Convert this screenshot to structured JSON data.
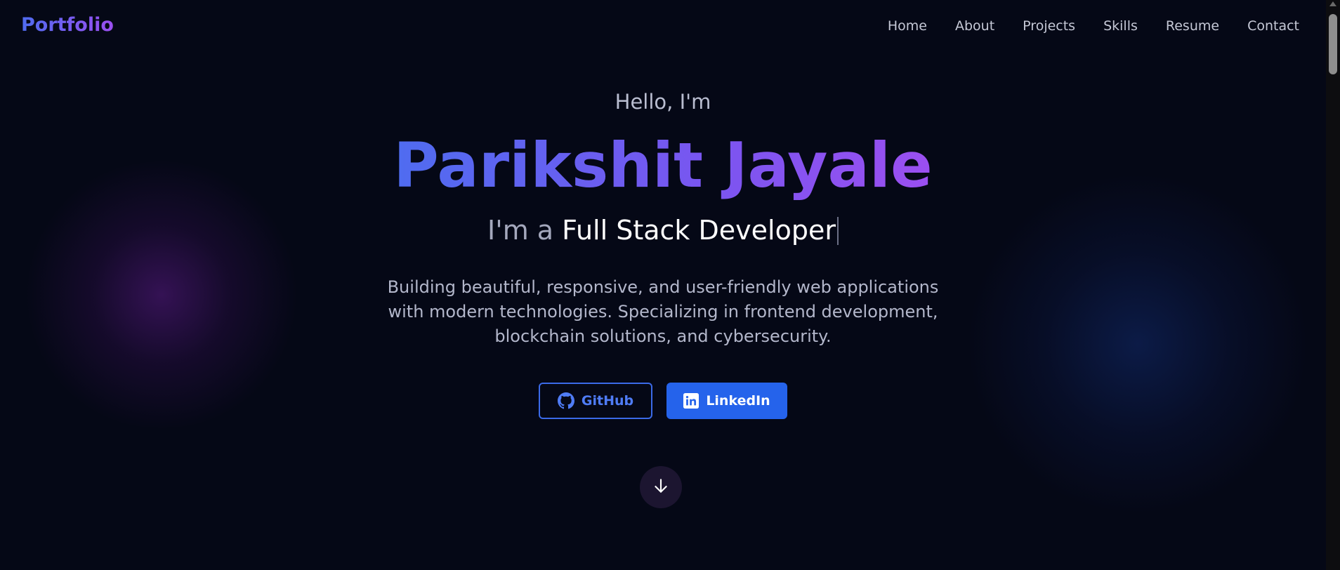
{
  "nav": {
    "logo": "Portfolio",
    "links": [
      "Home",
      "About",
      "Projects",
      "Skills",
      "Resume",
      "Contact"
    ]
  },
  "hero": {
    "greeting": "Hello, I'm",
    "name": "Parikshit Jayale",
    "role_prefix": "I'm a ",
    "role_text": "Full Stack Developer",
    "description": "Building beautiful, responsive, and user-friendly web applications with modern technologies. Specializing in frontend development, blockchain solutions, and cybersecurity."
  },
  "buttons": {
    "github_label": "GitHub",
    "linkedin_label": "LinkedIn"
  },
  "icons": {
    "github": "github-icon",
    "linkedin": "linkedin-icon",
    "scroll": "arrow-down-icon"
  },
  "colors": {
    "background": "#050816",
    "accent": "#2563eb",
    "gradient_start": "#4f6cf0",
    "gradient_end": "#9b4ff0"
  }
}
